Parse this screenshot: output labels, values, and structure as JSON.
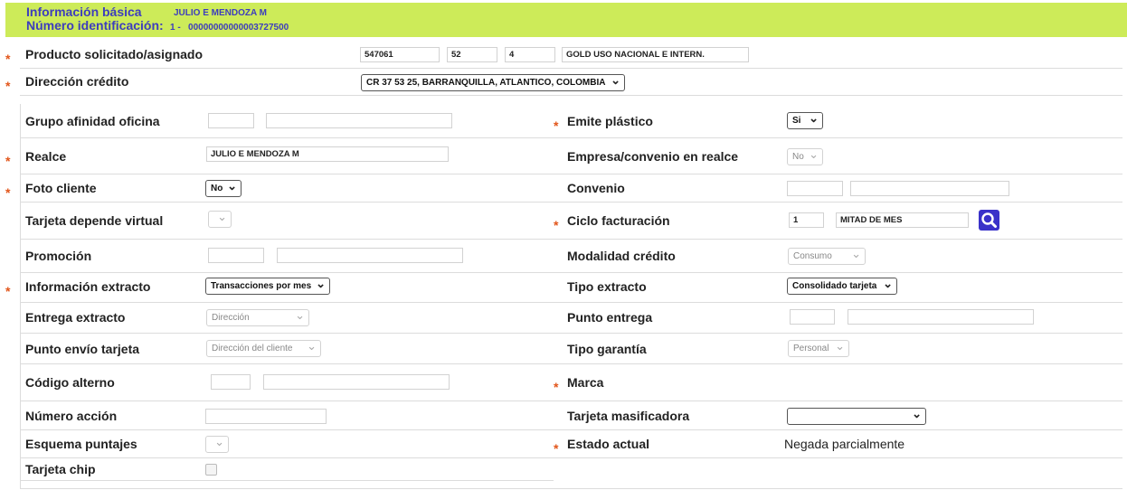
{
  "header": {
    "basic_info_label": "Información básica",
    "client_name": "JULIO E MENDOZA M",
    "id_label": "Número identificación:",
    "id_value": "1 -   00000000000003727500"
  },
  "fields": {
    "producto": {
      "label": "Producto solicitado/asignado",
      "code1": "547061",
      "code2": "52",
      "code3": "4",
      "description": "GOLD USO NACIONAL E INTERN."
    },
    "direccion_credito": {
      "label": "Dirección crédito",
      "selected": "CR 37 53 25, BARRANQUILLA, ATLANTICO, COLOMBIA"
    },
    "grupo_afinidad": {
      "label": "Grupo afinidad oficina",
      "code": "",
      "name": ""
    },
    "emite_plastico": {
      "label": "Emite plástico",
      "selected": "Si"
    },
    "realce": {
      "label": "Realce",
      "value": "JULIO E MENDOZA M"
    },
    "empresa_convenio": {
      "label": "Empresa/convenio en realce",
      "selected": "No"
    },
    "foto_cliente": {
      "label": "Foto cliente",
      "selected": "No"
    },
    "convenio": {
      "label": "Convenio",
      "code": "",
      "name": ""
    },
    "tarjeta_depende_virtual": {
      "label": "Tarjeta depende virtual",
      "selected": ""
    },
    "ciclo_facturacion": {
      "label": "Ciclo facturación",
      "code": "1",
      "name": "MITAD DE MES"
    },
    "promocion": {
      "label": "Promoción",
      "code": "",
      "name": ""
    },
    "modalidad_credito": {
      "label": "Modalidad crédito",
      "selected": "Consumo"
    },
    "informacion_extracto": {
      "label": "Información extracto",
      "selected": "Transacciones por mes"
    },
    "tipo_extracto": {
      "label": "Tipo extracto",
      "selected": "Consolidado tarjeta"
    },
    "entrega_extracto": {
      "label": "Entrega extracto",
      "selected": "Dirección"
    },
    "punto_entrega": {
      "label": "Punto entrega",
      "code": "",
      "name": ""
    },
    "punto_envio_tarjeta": {
      "label": "Punto envío tarjeta",
      "selected": "Dirección del cliente"
    },
    "tipo_garantia": {
      "label": "Tipo garantía",
      "selected": "Personal"
    },
    "codigo_alterno": {
      "label": "Código alterno",
      "code": "",
      "name": ""
    },
    "marca": {
      "label": "Marca"
    },
    "numero_accion": {
      "label": "Número acción",
      "value": ""
    },
    "tarjeta_masificadora": {
      "label": "Tarjeta masificadora",
      "selected": ""
    },
    "esquema_puntajes": {
      "label": "Esquema puntajes",
      "selected": ""
    },
    "estado_actual": {
      "label": "Estado actual",
      "value": "Negada parcialmente"
    },
    "tarjeta_chip": {
      "label": "Tarjeta chip",
      "checked": false
    }
  },
  "required_marker": "*",
  "colors": {
    "header_bg": "#cdeb59",
    "header_text": "#3d3dbd",
    "required_star": "#e2561b",
    "search_button": "#3a32c9"
  },
  "icons": {
    "search": "search-icon"
  }
}
